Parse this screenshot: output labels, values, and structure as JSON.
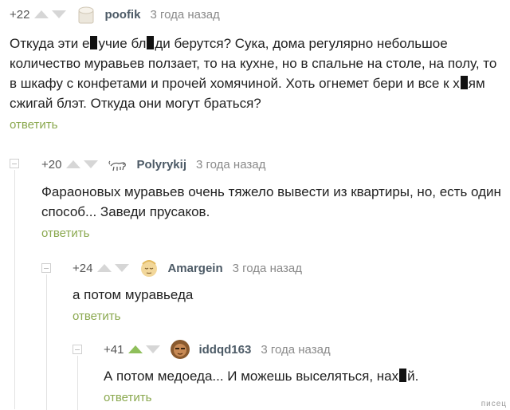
{
  "comments": [
    {
      "rating": "+22",
      "upvoted": false,
      "author": "poofik",
      "time": "3 года назад",
      "avatar_icon": "box-avatar-icon",
      "text_part1": "Откуда эти е",
      "text_part2": "учие бл",
      "text_part3": "ди берутся? Сука, дома регулярно небольшое количество муравьев ползает, то на кухне, но в спальне на столе, на полу, то в шкафу с конфетами и прочей хомячиной. Хоть огнемет бери и все к х",
      "text_part4": "ям сжигай блэт. Откуда они могут браться?",
      "reply_label": "ответить"
    },
    {
      "rating": "+20",
      "upvoted": false,
      "author": "Polyrykij",
      "time": "3 года назад",
      "avatar_icon": "dog-sketch-avatar-icon",
      "text": "Фараоновых муравьев очень тяжело вывести из квартиры, но, есть один способ... Заведи прусаков.",
      "reply_label": "ответить"
    },
    {
      "rating": "+24",
      "upvoted": false,
      "author": "Amargein",
      "time": "3 года назад",
      "avatar_icon": "sleeping-face-avatar-icon",
      "text": "а потом муравьеда",
      "reply_label": "ответить"
    },
    {
      "rating": "+41",
      "upvoted": true,
      "author": "iddqd163",
      "time": "3 года назад",
      "avatar_icon": "face-photo-avatar-icon",
      "text_part1": "А потом медоеда... И можешь выселяться, нах",
      "text_part2": "й.",
      "reply_label": "ответить"
    }
  ],
  "watermark": "писец",
  "colors": {
    "reply_link": "#8aa84e",
    "author": "#4c5a66",
    "upvote_active": "#8fbf5b",
    "vote_inactive": "#d6d6d6"
  }
}
